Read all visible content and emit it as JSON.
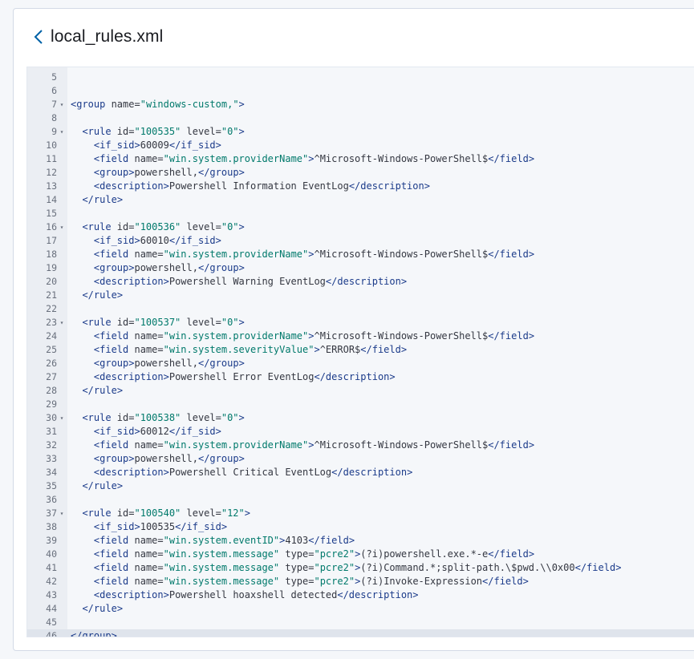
{
  "header": {
    "title": "local_rules.xml",
    "back_icon": "chevron-left-icon"
  },
  "editor": {
    "active_line": 46,
    "lines": [
      {
        "n": "5",
        "fold": false,
        "text": ""
      },
      {
        "n": "6",
        "fold": false,
        "text": ""
      },
      {
        "n": "7",
        "fold": true,
        "text": "<group name=\"windows-custom,\">"
      },
      {
        "n": "8",
        "fold": false,
        "text": ""
      },
      {
        "n": "9",
        "fold": true,
        "text": "  <rule id=\"100535\" level=\"0\">"
      },
      {
        "n": "10",
        "fold": false,
        "text": "    <if_sid>60009</if_sid>"
      },
      {
        "n": "11",
        "fold": false,
        "text": "    <field name=\"win.system.providerName\">^Microsoft-Windows-PowerShell$</field>"
      },
      {
        "n": "12",
        "fold": false,
        "text": "    <group>powershell,</group>"
      },
      {
        "n": "13",
        "fold": false,
        "text": "    <description>Powershell Information EventLog</description>"
      },
      {
        "n": "14",
        "fold": false,
        "text": "  </rule>"
      },
      {
        "n": "15",
        "fold": false,
        "text": ""
      },
      {
        "n": "16",
        "fold": true,
        "text": "  <rule id=\"100536\" level=\"0\">"
      },
      {
        "n": "17",
        "fold": false,
        "text": "    <if_sid>60010</if_sid>"
      },
      {
        "n": "18",
        "fold": false,
        "text": "    <field name=\"win.system.providerName\">^Microsoft-Windows-PowerShell$</field>"
      },
      {
        "n": "19",
        "fold": false,
        "text": "    <group>powershell,</group>"
      },
      {
        "n": "20",
        "fold": false,
        "text": "    <description>Powershell Warning EventLog</description>"
      },
      {
        "n": "21",
        "fold": false,
        "text": "  </rule>"
      },
      {
        "n": "22",
        "fold": false,
        "text": ""
      },
      {
        "n": "23",
        "fold": true,
        "text": "  <rule id=\"100537\" level=\"0\">"
      },
      {
        "n": "24",
        "fold": false,
        "text": "    <field name=\"win.system.providerName\">^Microsoft-Windows-PowerShell$</field>"
      },
      {
        "n": "25",
        "fold": false,
        "text": "    <field name=\"win.system.severityValue\">^ERROR$</field>"
      },
      {
        "n": "26",
        "fold": false,
        "text": "    <group>powershell,</group>"
      },
      {
        "n": "27",
        "fold": false,
        "text": "    <description>Powershell Error EventLog</description>"
      },
      {
        "n": "28",
        "fold": false,
        "text": "  </rule>"
      },
      {
        "n": "29",
        "fold": false,
        "text": ""
      },
      {
        "n": "30",
        "fold": true,
        "text": "  <rule id=\"100538\" level=\"0\">"
      },
      {
        "n": "31",
        "fold": false,
        "text": "    <if_sid>60012</if_sid>"
      },
      {
        "n": "32",
        "fold": false,
        "text": "    <field name=\"win.system.providerName\">^Microsoft-Windows-PowerShell$</field>"
      },
      {
        "n": "33",
        "fold": false,
        "text": "    <group>powershell,</group>"
      },
      {
        "n": "34",
        "fold": false,
        "text": "    <description>Powershell Critical EventLog</description>"
      },
      {
        "n": "35",
        "fold": false,
        "text": "  </rule>"
      },
      {
        "n": "36",
        "fold": false,
        "text": ""
      },
      {
        "n": "37",
        "fold": true,
        "text": "  <rule id=\"100540\" level=\"12\">"
      },
      {
        "n": "38",
        "fold": false,
        "text": "    <if_sid>100535</if_sid>"
      },
      {
        "n": "39",
        "fold": false,
        "text": "    <field name=\"win.system.eventID\">4103</field>"
      },
      {
        "n": "40",
        "fold": false,
        "text": "    <field name=\"win.system.message\" type=\"pcre2\">(?i)powershell.exe.*-e</field>"
      },
      {
        "n": "41",
        "fold": false,
        "text": "    <field name=\"win.system.message\" type=\"pcre2\">(?i)Command.*;split-path.\\$pwd.\\\\0x00</field>"
      },
      {
        "n": "42",
        "fold": false,
        "text": "    <field name=\"win.system.message\" type=\"pcre2\">(?i)Invoke-Expression</field>"
      },
      {
        "n": "43",
        "fold": false,
        "text": "    <description>Powershell hoaxshell detected</description>"
      },
      {
        "n": "44",
        "fold": false,
        "text": "  </rule>"
      },
      {
        "n": "45",
        "fold": false,
        "text": ""
      },
      {
        "n": "46",
        "fold": false,
        "text": "</group>"
      }
    ]
  },
  "colors": {
    "tag": "#1b3b8a",
    "string": "#00796b",
    "text": "#343741",
    "gutter": "#ebeef3"
  }
}
